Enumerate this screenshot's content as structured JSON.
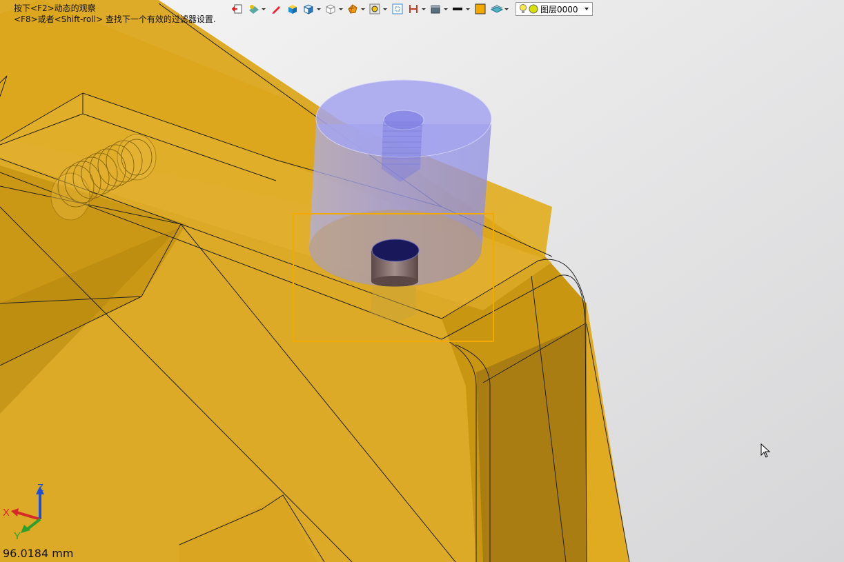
{
  "hints": {
    "line1": "按下<F2>动态的观察",
    "line2": "<F8>或者<Shift-roll> 查找下一个有效的过滤器设置."
  },
  "toolbar": {
    "icons": [
      "exit-icon",
      "filter-icon",
      "pencil-icon",
      "cube-shaded-icon",
      "view-cube-icon",
      "wire-cube-icon",
      "render-icon",
      "snap-icon",
      "frame-icon",
      "dimension-icon",
      "surface-icon",
      "line-style-icon",
      "color-swatch",
      "plane-icon",
      "bulb-icon"
    ],
    "layer": {
      "label": "图层0000",
      "color": "#d8e000"
    }
  },
  "triad": {
    "x": "X",
    "y": "Y",
    "z": "Z"
  },
  "scale": "96.0184 mm",
  "colors": {
    "part": "#e0aa18",
    "partDark": "#b8850d",
    "cylinder": "#9c9ce8",
    "selection": "#f2a900",
    "background": "#e9e9ea"
  }
}
